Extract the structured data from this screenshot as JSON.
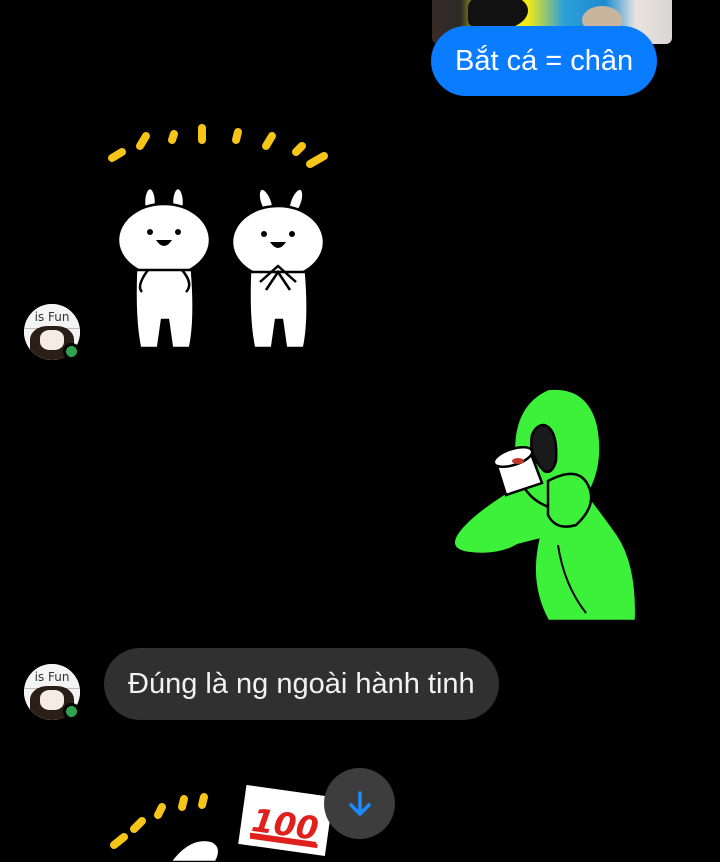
{
  "messages": {
    "outgoing_text": "Bắt cá = chân",
    "incoming_text": "Đúng là ng ngoài hành tinh"
  },
  "stickers": {
    "bunnies": "bunnies-cheering-sticker",
    "alien": "green-alien-drinking-sticker",
    "hundred": "100"
  },
  "avatar": {
    "caption": "is Fun"
  },
  "colors": {
    "outgoing_bubble": "#0a7cff",
    "incoming_bubble": "#303030",
    "online": "#31a24c",
    "alien": "#3df03a",
    "scroll_arrow": "#1a8cff"
  },
  "icons": {
    "scroll_down": "arrow-down-icon"
  }
}
